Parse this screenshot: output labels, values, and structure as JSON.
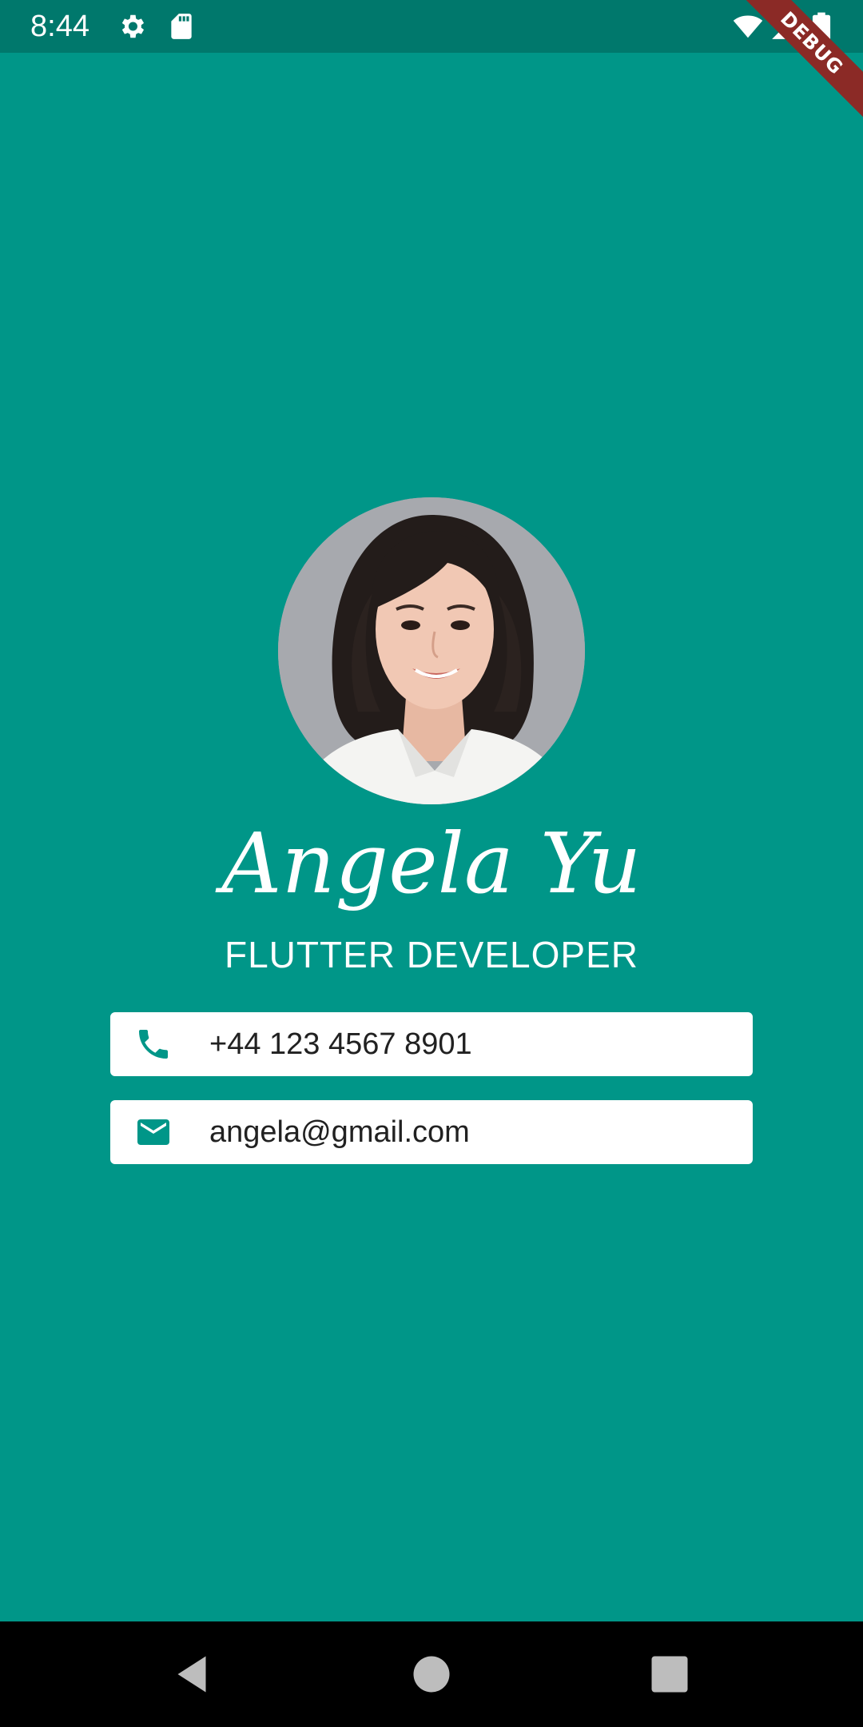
{
  "status_bar": {
    "time": "8:44",
    "icons": [
      "gear-icon",
      "sd-card-icon",
      "wifi-icon",
      "signal-icon",
      "battery-icon"
    ]
  },
  "debug_banner": "DEBUG",
  "profile": {
    "name": "Angela Yu",
    "title": "FLUTTER DEVELOPER"
  },
  "contacts": [
    {
      "icon": "phone-icon",
      "text": "+44 123 4567 8901"
    },
    {
      "icon": "mail-icon",
      "text": "angela@gmail.com"
    }
  ],
  "navigation": {
    "buttons": [
      "back-icon",
      "home-icon",
      "recents-icon"
    ]
  },
  "colors": {
    "background": "#009688",
    "status_bar": "#00786c",
    "card": "#ffffff",
    "icon_accent": "#009688",
    "debug_banner": "#8b2a26"
  }
}
